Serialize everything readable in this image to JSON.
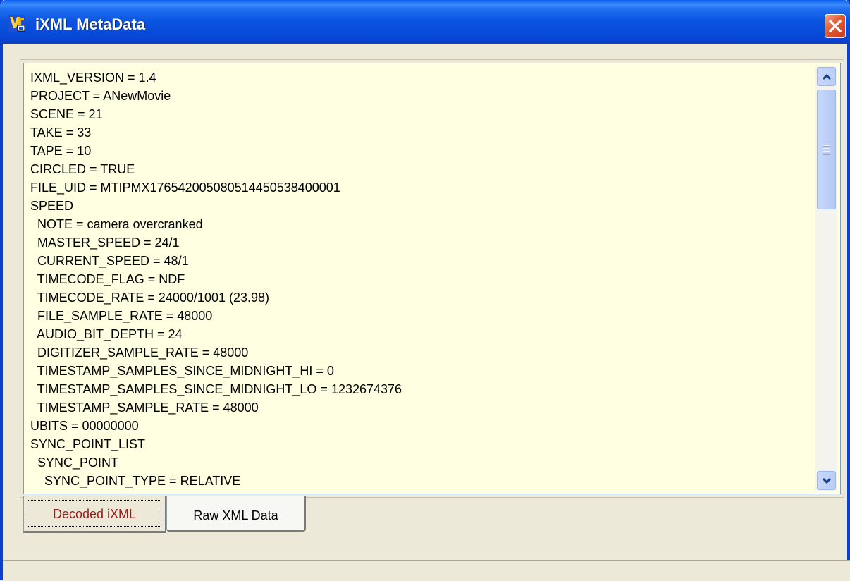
{
  "window": {
    "title": "iXML MetaData",
    "close_icon": "close-icon",
    "app_icon": "app-icon"
  },
  "metadata_lines": [
    "IXML_VERSION = 1.4",
    "PROJECT = ANewMovie",
    "SCENE = 21",
    "TAKE = 33",
    "TAPE = 10",
    "CIRCLED = TRUE",
    "FILE_UID = MTIPMX176542005080514450538400001",
    "SPEED",
    "  NOTE = camera overcranked",
    "  MASTER_SPEED = 24/1",
    "  CURRENT_SPEED = 48/1",
    "  TIMECODE_FLAG = NDF",
    "  TIMECODE_RATE = 24000/1001 (23.98)",
    "  FILE_SAMPLE_RATE = 48000",
    "  AUDIO_BIT_DEPTH = 24",
    "  DIGITIZER_SAMPLE_RATE = 48000",
    "  TIMESTAMP_SAMPLES_SINCE_MIDNIGHT_HI = 0",
    "  TIMESTAMP_SAMPLES_SINCE_MIDNIGHT_LO = 1232674376",
    "  TIMESTAMP_SAMPLE_RATE = 48000",
    "UBITS = 00000000",
    "SYNC_POINT_LIST",
    "  SYNC_POINT",
    "    SYNC_POINT_TYPE = RELATIVE"
  ],
  "tabs": [
    {
      "label": "Decoded iXML",
      "selected": true
    },
    {
      "label": "Raw XML Data",
      "selected": false
    }
  ],
  "scrollbar": {
    "position": 0.0
  },
  "colors": {
    "titlebar": "#0a53e0",
    "text_background": "#ffffe1",
    "selected_tab_text": "#9b1a1a",
    "close_button": "#e35a34"
  }
}
